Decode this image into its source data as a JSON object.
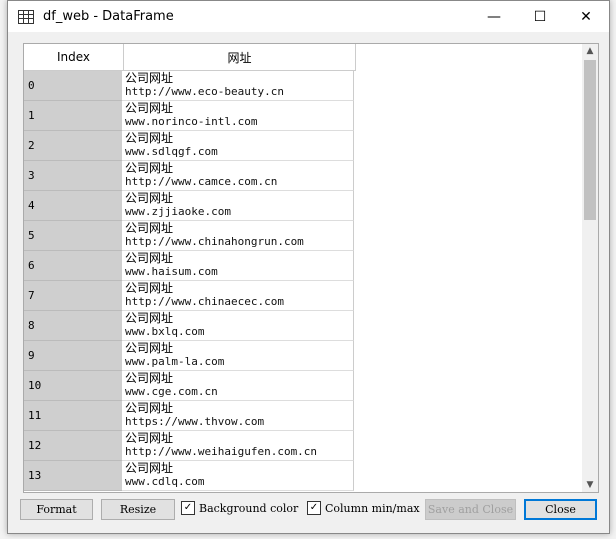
{
  "window": {
    "title": "df_web - DataFrame",
    "minimize": "—",
    "maximize": "☐",
    "close": "✕"
  },
  "table": {
    "headers": [
      "Index",
      "网址"
    ],
    "rows": [
      {
        "index": "0",
        "label": "公司网址",
        "url": "http://www.eco-beauty.cn"
      },
      {
        "index": "1",
        "label": "公司网址",
        "url": "www.norinco-intl.com"
      },
      {
        "index": "2",
        "label": "公司网址",
        "url": "www.sdlqgf.com"
      },
      {
        "index": "3",
        "label": "公司网址",
        "url": "http://www.camce.com.cn"
      },
      {
        "index": "4",
        "label": "公司网址",
        "url": "www.zjjiaoke.com"
      },
      {
        "index": "5",
        "label": "公司网址",
        "url": "http://www.chinahongrun.com"
      },
      {
        "index": "6",
        "label": "公司网址",
        "url": "www.haisum.com"
      },
      {
        "index": "7",
        "label": "公司网址",
        "url": "http://www.chinaecec.com"
      },
      {
        "index": "8",
        "label": "公司网址",
        "url": "www.bxlq.com"
      },
      {
        "index": "9",
        "label": "公司网址",
        "url": "www.palm-la.com"
      },
      {
        "index": "10",
        "label": "公司网址",
        "url": "www.cge.com.cn"
      },
      {
        "index": "11",
        "label": "公司网址",
        "url": "https://www.thvow.com"
      },
      {
        "index": "12",
        "label": "公司网址",
        "url": "http://www.weihaigufen.com.cn"
      },
      {
        "index": "13",
        "label": "公司网址",
        "url": "www.cdlq.com"
      }
    ]
  },
  "buttons": {
    "format": "Format",
    "resize": "Resize",
    "save_close": "Save and Close",
    "close": "Close"
  },
  "checkboxes": {
    "background_color": {
      "label": "Background color",
      "checked": true
    },
    "column_minmax": {
      "label": "Column min/max",
      "checked": true
    }
  }
}
